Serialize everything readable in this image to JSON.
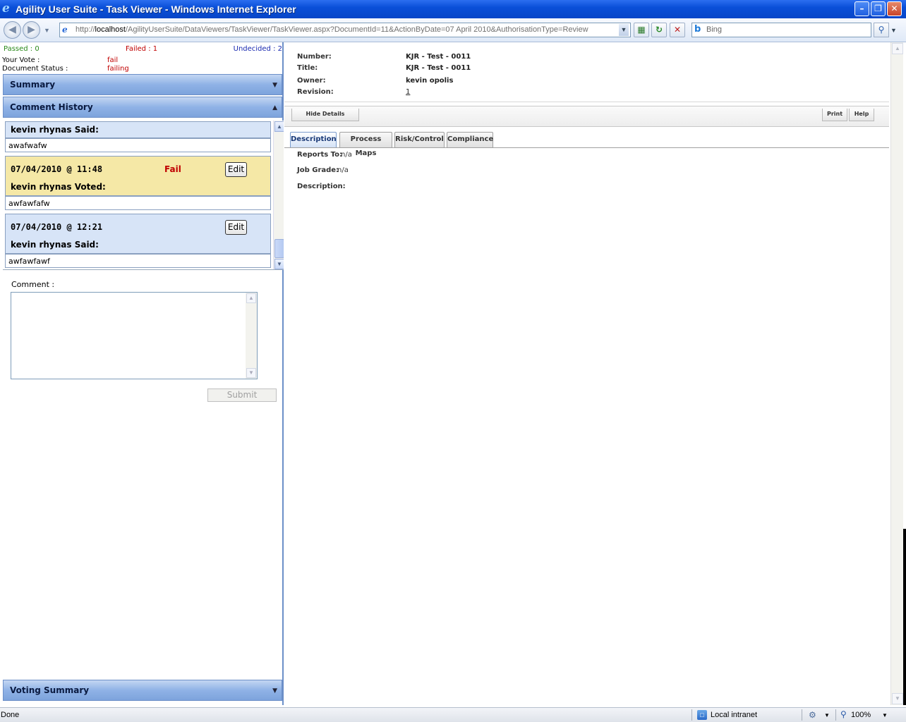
{
  "window": {
    "title": "Agility User Suite - Task Viewer - Windows Internet Explorer",
    "minimize": "–",
    "restore": "❐",
    "close": "✕"
  },
  "address": {
    "prefix": "http://",
    "host": "localhost",
    "path": "/AgilityUserSuite/DataViewers/TaskViewer/TaskViewer.aspx?DocumentId=11&ActionByDate=07 April 2010&AuthorisationType=Review",
    "search_placeholder": "Bing"
  },
  "votes": {
    "passed": "Passed : 0",
    "failed": "Failed : 1",
    "undecided": "Undecided : 2",
    "your_vote_label": "Your Vote :",
    "your_vote_value": "fail",
    "document_status_label": "Document Status :",
    "document_status_value": "failing"
  },
  "accordion": {
    "summary": "Summary",
    "comment_history": "Comment History",
    "voting_summary": "Voting Summary"
  },
  "history": [
    {
      "type": "said",
      "who": "kevin rhynas Said:",
      "comment": "awafwafw"
    },
    {
      "type": "voted",
      "date": "07/04/2010 @ 11:48",
      "status": "Fail",
      "edit": "Edit",
      "who": "kevin rhynas Voted:",
      "comment": "awfawfafw"
    },
    {
      "type": "said",
      "date": "07/04/2010 @ 12:21",
      "edit": "Edit",
      "who": "kevin rhynas Said:",
      "comment": "awfawfawf"
    }
  ],
  "comment_form": {
    "label": "Comment :",
    "submit": "Submit"
  },
  "details": {
    "number_label": "Number:",
    "number_value": "KJR - Test - 0011",
    "title_label": "Title:",
    "title_value": "KJR - Test - 0011",
    "owner_label": "Owner:",
    "owner_value": "kevin opolis",
    "revision_label": "Revision:",
    "revision_value": "1"
  },
  "toolbar": {
    "hide_details": "Hide Details",
    "print": "Print",
    "help": "Help"
  },
  "tabs": [
    "Description",
    "Process Maps",
    "Risk/Control",
    "Compliance"
  ],
  "description": {
    "reports_to_label": "Reports To:",
    "reports_to_value": "n/a",
    "job_grade_label": "Job Grade:",
    "job_grade_value": "n/a",
    "description_label": "Description:"
  },
  "statusbar": {
    "done": "Done",
    "zone": "Local intranet",
    "zoom": "100%"
  }
}
